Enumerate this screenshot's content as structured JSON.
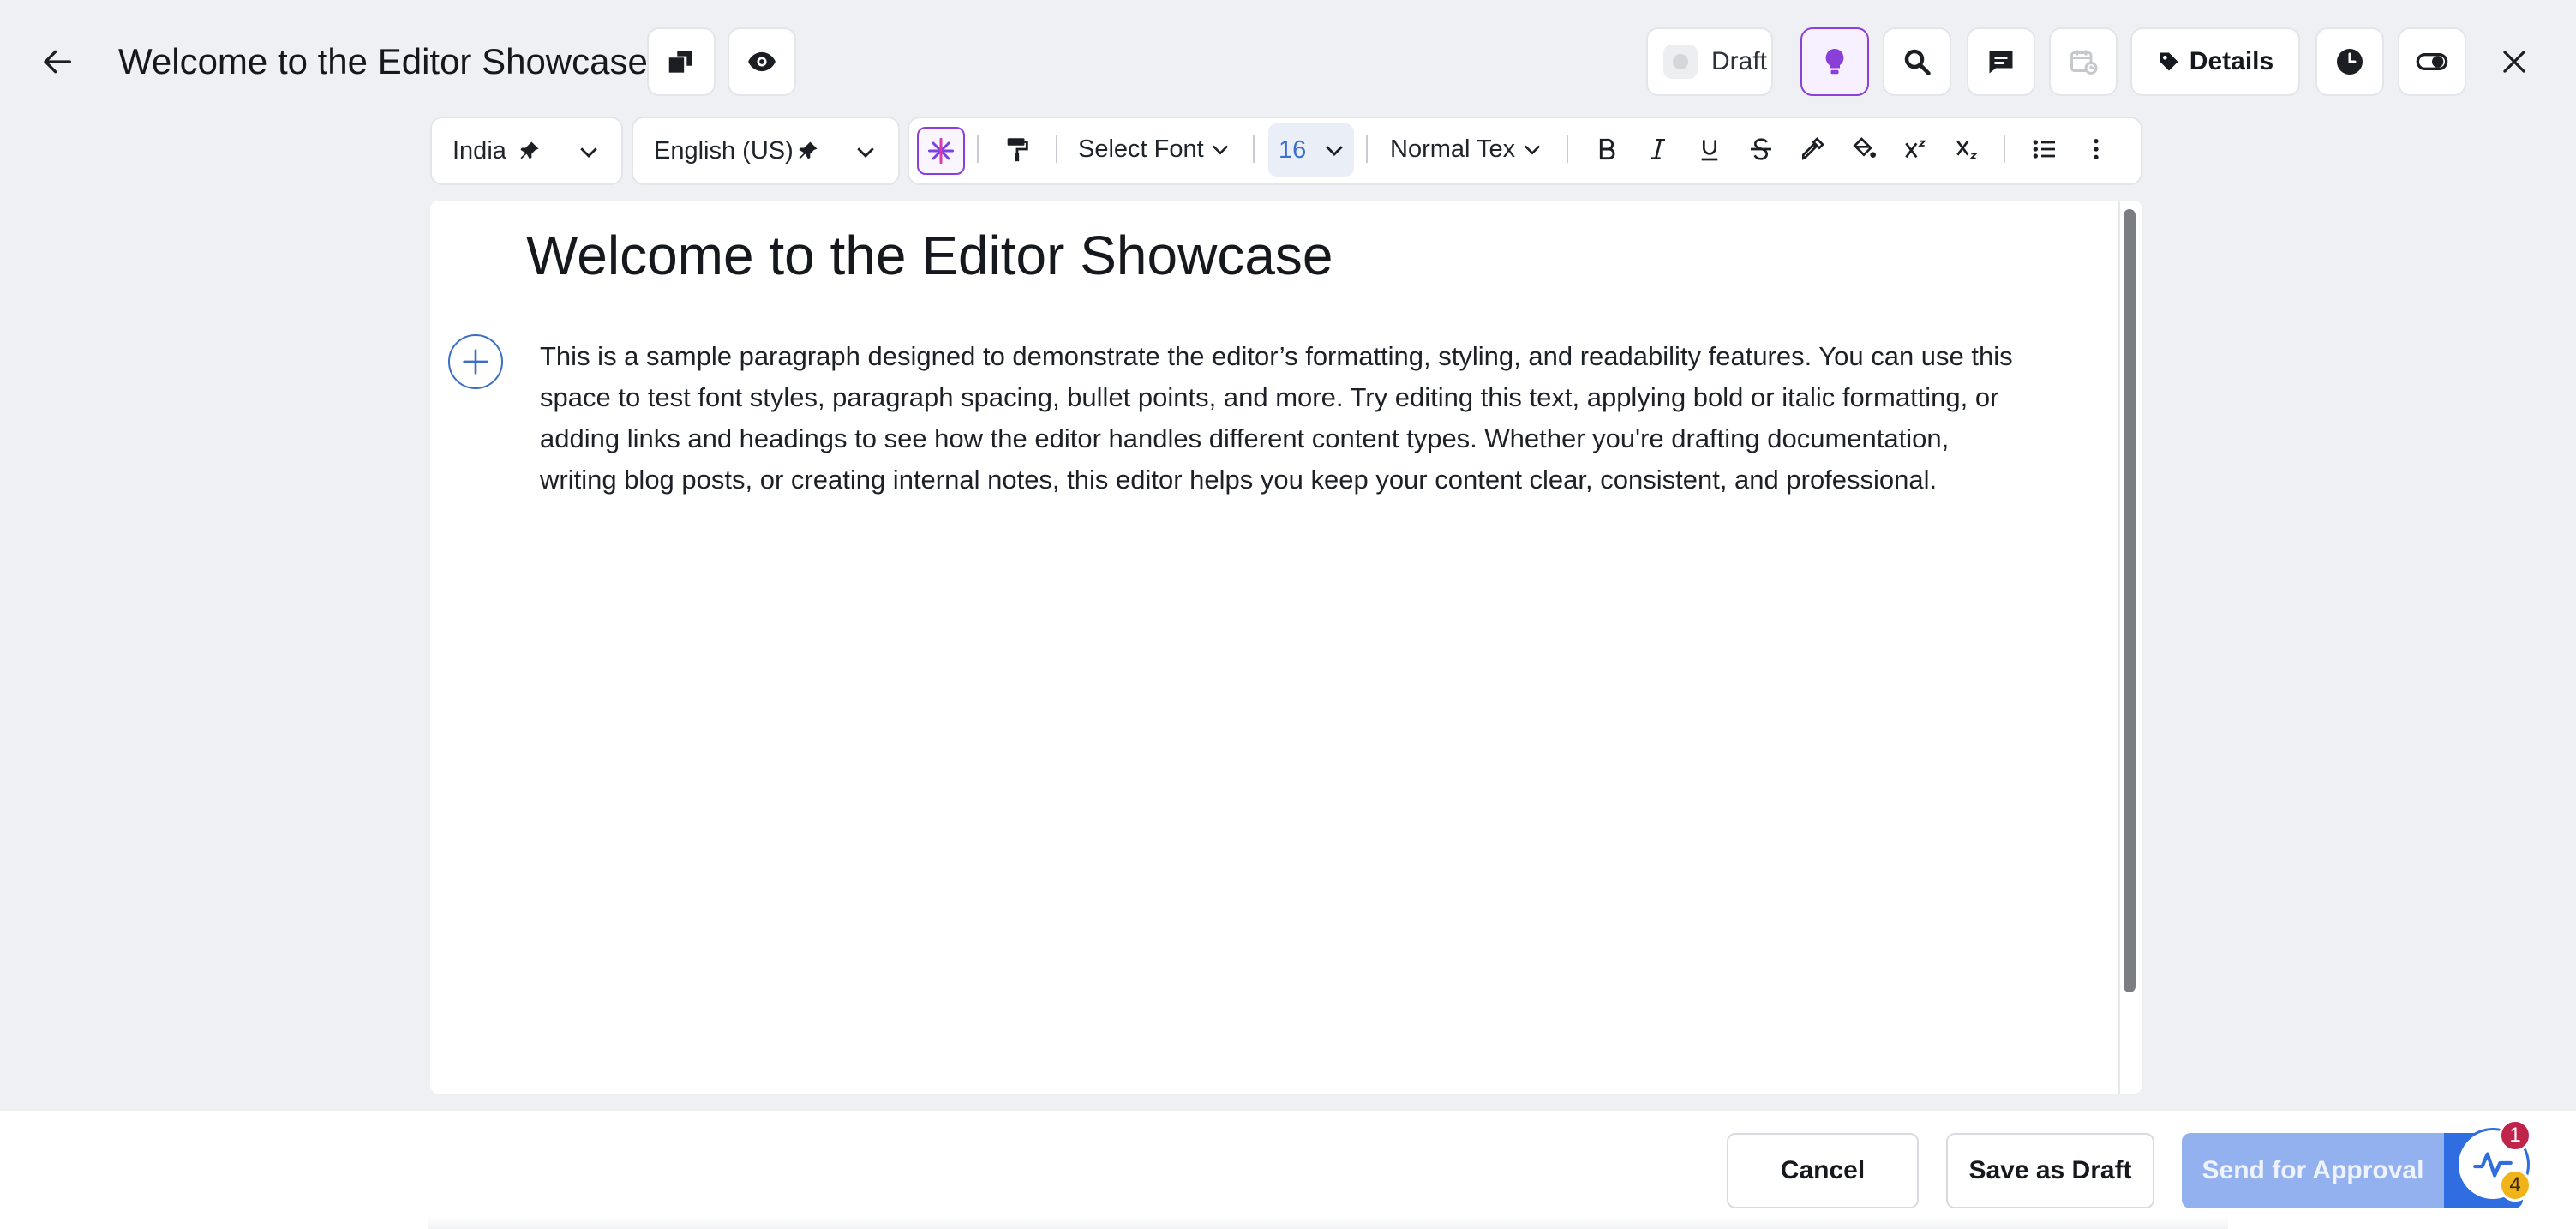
{
  "header": {
    "back_icon": "arrow-left-icon",
    "title": "Welcome to the Editor Showcase",
    "status_label": "Draft",
    "details_label": "Details",
    "accent_color": "#8b3fd9"
  },
  "toolbar": {
    "country": "India",
    "language": "English (US)",
    "font_select": "Select Font",
    "font_size": "16",
    "text_style": "Normal Tex"
  },
  "document": {
    "heading": "Welcome to the Editor Showcase",
    "paragraph": "This is a sample paragraph designed to demonstrate the editor’s formatting, styling, and readability features. You can use this space to test font styles, paragraph spacing, bullet points, and more. Try editing this text, applying bold or italic formatting, or adding links and headings to see how the editor handles different content types. Whether you're drafting documentation, writing blog posts, or creating internal notes, this editor helps you keep your content clear, consistent, and professional."
  },
  "footer": {
    "cancel_label": "Cancel",
    "save_draft_label": "Save as Draft",
    "send_approval_label": "Send for Approval",
    "badge_count_red": "1",
    "badge_count_yellow": "4"
  }
}
